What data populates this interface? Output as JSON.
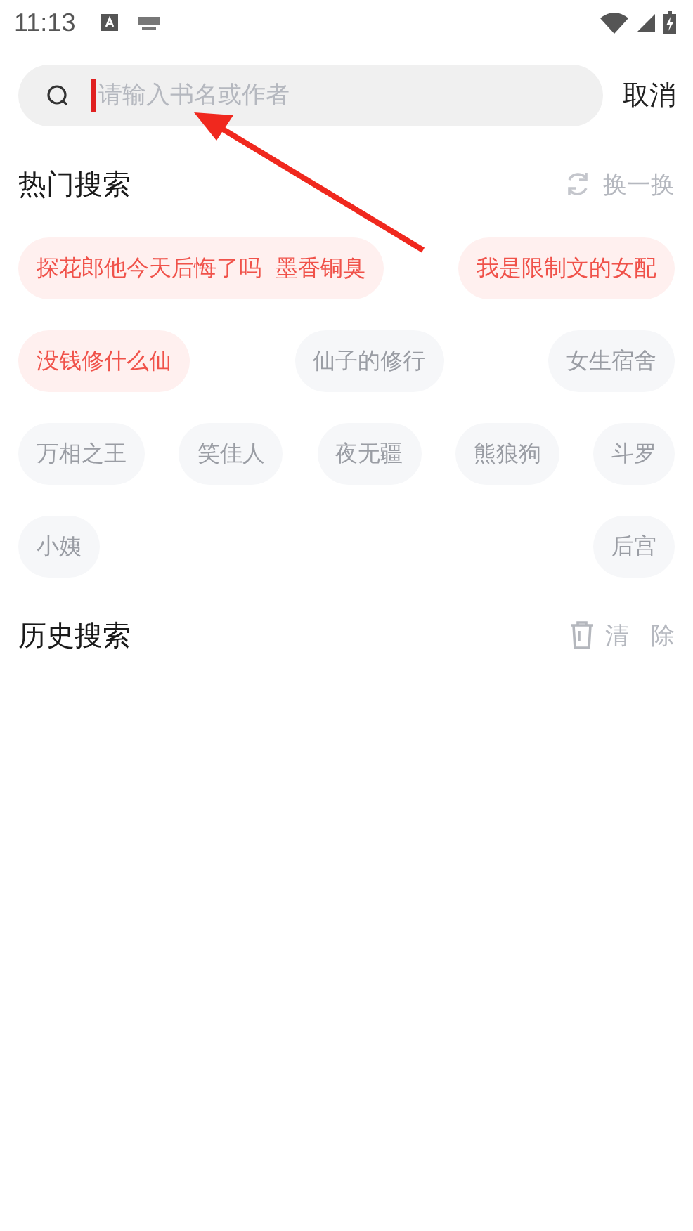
{
  "status_bar": {
    "time": "11:13"
  },
  "search": {
    "placeholder": "请输入书名或作者",
    "cancel": "取消"
  },
  "hot_search": {
    "title": "热门搜索",
    "refresh": "换一换",
    "rows": [
      {
        "tags": [
          {
            "label": "探花郎他今天后悔了吗  墨香铜臭",
            "highlighted": true
          },
          {
            "label": "我是限制文的女配",
            "highlighted": true
          }
        ]
      },
      {
        "tags": [
          {
            "label": "没钱修什么仙",
            "highlighted": true
          },
          {
            "label": "仙子的修行",
            "highlighted": false
          },
          {
            "label": "女生宿舍",
            "highlighted": false
          }
        ]
      },
      {
        "tags": [
          {
            "label": "万相之王",
            "highlighted": false
          },
          {
            "label": "笑佳人",
            "highlighted": false
          },
          {
            "label": "夜无疆",
            "highlighted": false
          },
          {
            "label": "熊狼狗",
            "highlighted": false
          },
          {
            "label": "斗罗",
            "highlighted": false
          }
        ]
      },
      {
        "tags": [
          {
            "label": "小姨",
            "highlighted": false
          },
          {
            "label": "后宫",
            "highlighted": false
          }
        ]
      }
    ]
  },
  "history": {
    "title": "历史搜索",
    "clear": "清 除"
  }
}
